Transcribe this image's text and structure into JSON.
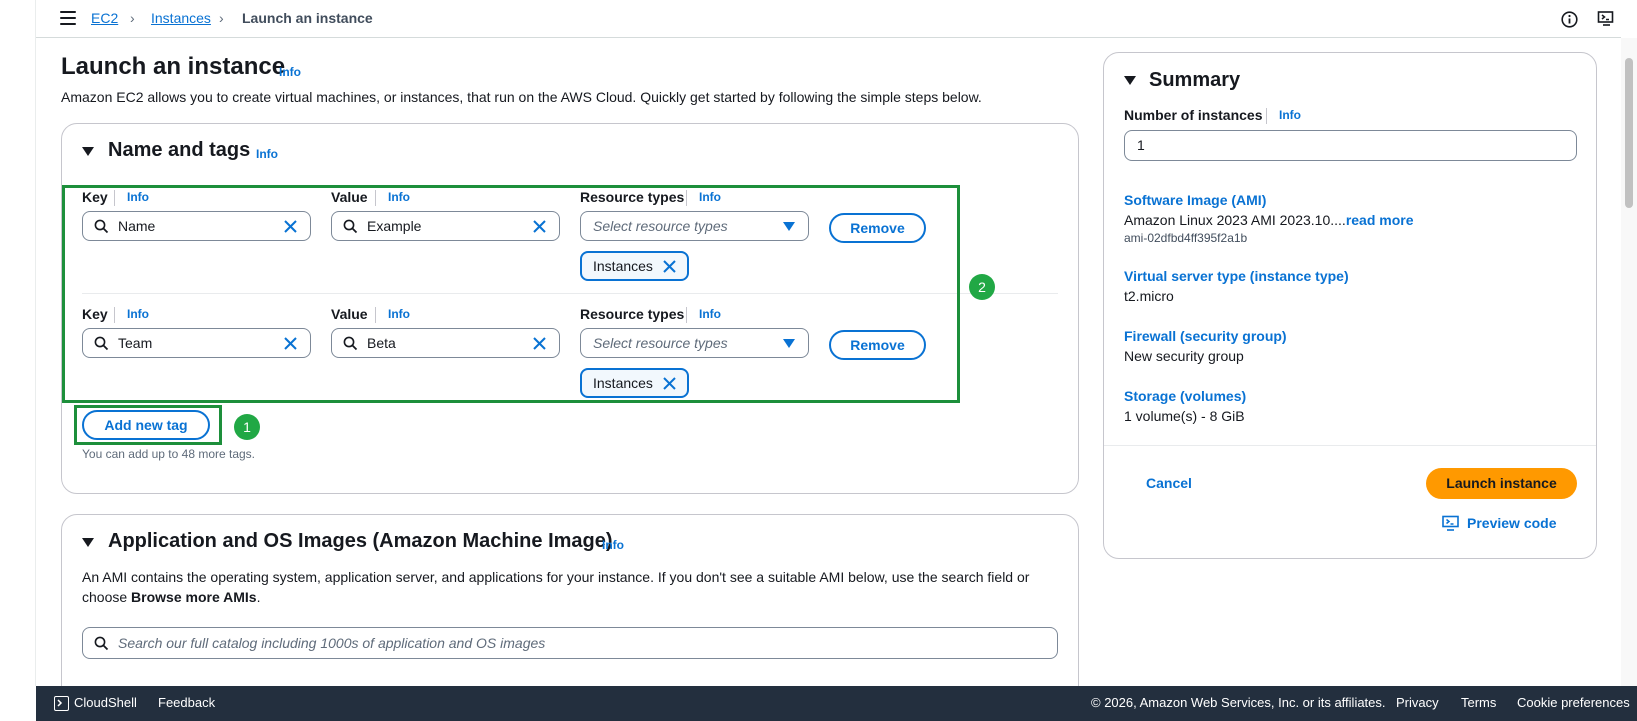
{
  "breadcrumb": {
    "items": [
      "EC2",
      "Instances"
    ],
    "current": "Launch an instance"
  },
  "page": {
    "title": "Launch an instance",
    "info": "Info",
    "description": "Amazon EC2 allows you to create virtual machines, or instances, that run on the AWS Cloud. Quickly get started by following the simple steps below."
  },
  "name_tags": {
    "title": "Name and tags",
    "info": "Info",
    "key_label": "Key",
    "value_label": "Value",
    "resource_label": "Resource types",
    "resource_placeholder": "Select resource types",
    "remove_label": "Remove",
    "rows": [
      {
        "key": "Name",
        "value": "Example",
        "token": "Instances"
      },
      {
        "key": "Team",
        "value": "Beta",
        "token": "Instances"
      }
    ],
    "add_label": "Add new tag",
    "hint": "You can add up to 48 more tags."
  },
  "annotations": {
    "one": "1",
    "two": "2"
  },
  "ami": {
    "title": "Application and OS Images (Amazon Machine Image)",
    "info": "Info",
    "description_1": "An AMI contains the operating system, application server, and applications for your instance. If you don't see a suitable AMI below, use the search field or",
    "description_2_prefix": "choose ",
    "description_2_bold": "Browse more AMIs",
    "description_2_suffix": ".",
    "search_placeholder": "Search our full catalog including 1000s of application and OS images"
  },
  "summary": {
    "title": "Summary",
    "num_label": "Number of instances",
    "info": "Info",
    "num_value": "1",
    "ami_key": "Software Image (AMI)",
    "ami_value": "Amazon Linux 2023 AMI 2023.10....",
    "ami_read_more": "read more",
    "ami_id": "ami-02dfbd4ff395f2a1b",
    "type_key": "Virtual server type (instance type)",
    "type_value": "t2.micro",
    "fw_key": "Firewall (security group)",
    "fw_value": "New security group",
    "storage_key": "Storage (volumes)",
    "storage_value": "1 volume(s) - 8 GiB",
    "cancel": "Cancel",
    "launch": "Launch instance",
    "preview": "Preview code"
  },
  "footer": {
    "cloudshell": "CloudShell",
    "feedback": "Feedback",
    "copyright": "© 2026, Amazon Web Services, Inc. or its affiliates.",
    "privacy": "Privacy",
    "terms": "Terms",
    "cookies": "Cookie preferences"
  },
  "colors": {
    "accent": "#0972d3",
    "launch": "#ff9900",
    "annotation": "#1d8f3b",
    "footer": "#232f3e"
  }
}
